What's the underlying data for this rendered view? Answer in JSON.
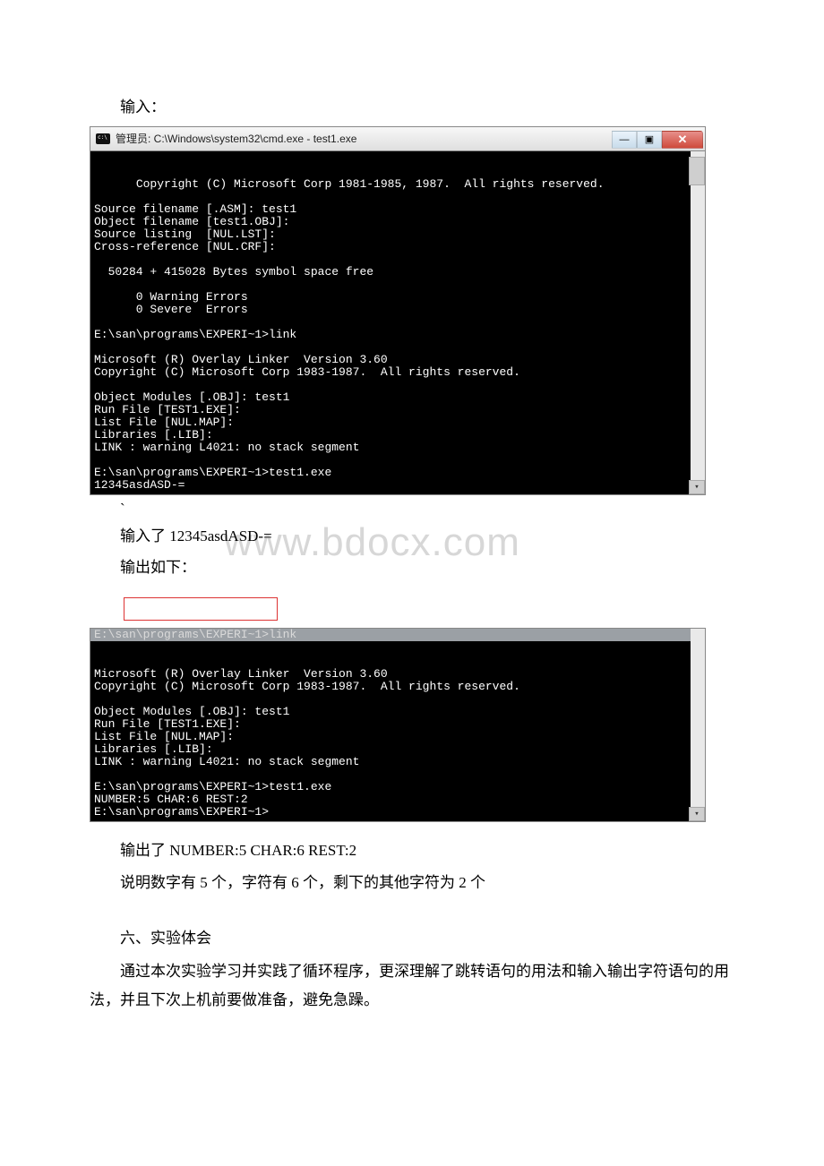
{
  "text": {
    "input_label": "输入：",
    "backtick": "`",
    "input_confirm": "输入了 12345asdASD-=",
    "output_label": "输出如下：",
    "output_stated": "输出了 NUMBER:5 CHAR:6 REST:2",
    "explanation": "说明数字有 5 个，字符有 6 个，剩下的其他字符为 2 个",
    "section6": "六、实验体会",
    "summary": "通过本次实验学习并实践了循环程序，更深理解了跳转语句的用法和输入输出字符语句的用法，并且下次上机前要做准备，避免急躁。"
  },
  "watermark": "www.bdocx.com",
  "terminal1": {
    "title": "管理员: C:\\Windows\\system32\\cmd.exe - test1.exe",
    "min_glyph": "—",
    "max_glyph": "▣",
    "close_glyph": "✕",
    "content": "Copyright (C) Microsoft Corp 1981-1985, 1987.  All rights reserved.\n\nSource filename [.ASM]: test1\nObject filename [test1.OBJ]:\nSource listing  [NUL.LST]:\nCross-reference [NUL.CRF]:\n\n  50284 + 415028 Bytes symbol space free\n\n      0 Warning Errors\n      0 Severe  Errors\n\nE:\\san\\programs\\EXPERI~1>link\n\nMicrosoft (R) Overlay Linker  Version 3.60\nCopyright (C) Microsoft Corp 1983-1987.  All rights reserved.\n\nObject Modules [.OBJ]: test1\nRun File [TEST1.EXE]:\nList File [NUL.MAP]:\nLibraries [.LIB]:\nLINK : warning L4021: no stack segment\n\nE:\\san\\programs\\EXPERI~1>test1.exe\n12345asdASD-="
  },
  "terminal2": {
    "head": "E:\\san\\programs\\EXPERI~1>link",
    "content": "\nMicrosoft (R) Overlay Linker  Version 3.60\nCopyright (C) Microsoft Corp 1983-1987.  All rights reserved.\n\nObject Modules [.OBJ]: test1\nRun File [TEST1.EXE]:\nList File [NUL.MAP]:\nLibraries [.LIB]:\nLINK : warning L4021: no stack segment\n\nE:\\san\\programs\\EXPERI~1>test1.exe\nNUMBER:5 CHAR:6 REST:2\nE:\\san\\programs\\EXPERI~1>"
  }
}
